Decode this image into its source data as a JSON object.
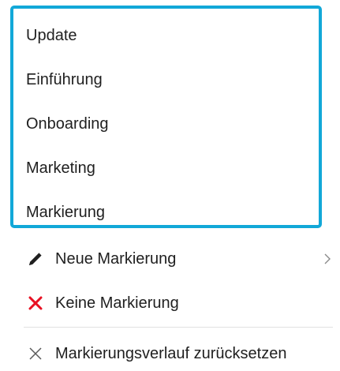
{
  "tag_list": {
    "items": [
      {
        "label": "Update"
      },
      {
        "label": "Einführung"
      },
      {
        "label": "Onboarding"
      },
      {
        "label": "Marketing"
      },
      {
        "label": "Markierung"
      }
    ],
    "highlight_color": "#12a8d8"
  },
  "actions": {
    "new_tag": {
      "label": "Neue Markierung",
      "icon": "pencil-icon",
      "submenu_icon": "chevron-right-icon"
    },
    "no_tag": {
      "label": "Keine Markierung",
      "icon": "red-x-icon",
      "icon_color": "#e81123"
    },
    "reset_history": {
      "label": "Markierungsverlauf zurücksetzen",
      "icon": "close-icon"
    }
  }
}
